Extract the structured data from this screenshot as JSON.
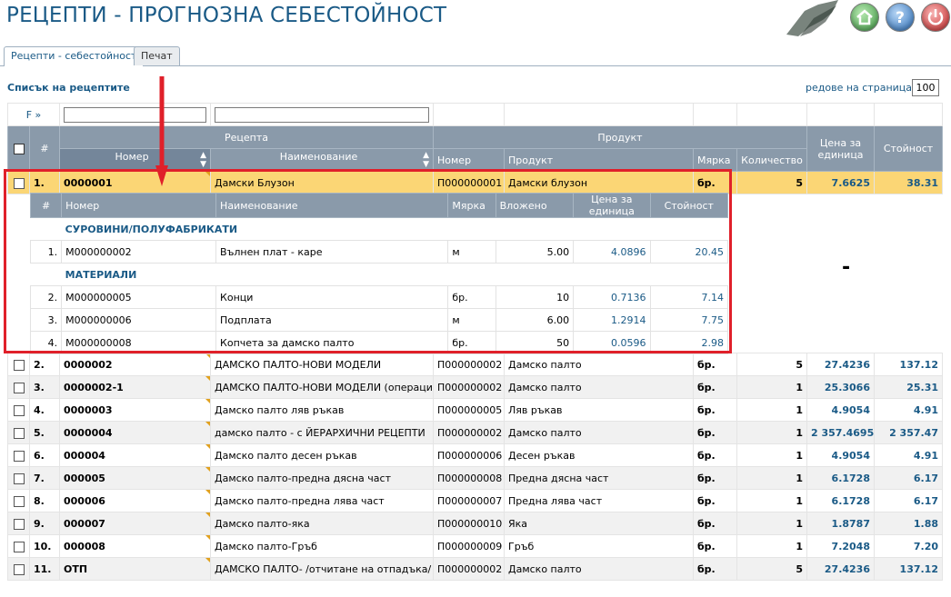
{
  "app": {
    "title": "РЕЦЕПТИ - ПРОГНОЗНА СЕБЕСТОЙНОСТ"
  },
  "header_buttons": [
    {
      "name": "home",
      "icon": "home-icon",
      "color": "#3f9a44"
    },
    {
      "name": "help",
      "icon": "help-icon",
      "color": "#2a6db8"
    },
    {
      "name": "power",
      "icon": "power-icon",
      "color": "#c62828"
    }
  ],
  "tabs": [
    {
      "label": "Рецепти - себестойност",
      "active": true
    },
    {
      "label": "Печат",
      "active": false
    }
  ],
  "list": {
    "title": "Списък на рецептите",
    "rows_label": "редове на страница",
    "rows_arrow": "»",
    "rows_value": "100",
    "filter_label": "F »"
  },
  "columns": {
    "hash": "#",
    "recipe_group": "Рецепта",
    "product_group": "Продукт",
    "number": "Номер",
    "name": "Наименование",
    "prod_number": "Номер",
    "product": "Продукт",
    "unit": "Мярка",
    "quantity": "Количество",
    "unit_price": "Цена за единица",
    "value": "Стойност"
  },
  "rows": [
    {
      "idx": "1.",
      "number": "0000001",
      "name": "Дамски Блузон",
      "prod_number": "П000000001",
      "product": "Дамски блузон",
      "unit": "бр.",
      "qty": "5",
      "price": "7.6625",
      "value": "38.31"
    },
    {
      "idx": "2.",
      "number": "0000002",
      "name": "ДАМСКО ПАЛТО-НОВИ МОДЕЛИ",
      "prod_number": "П000000002",
      "product": "Дамско палто",
      "unit": "бр.",
      "qty": "5",
      "price": "27.4236",
      "value": "137.12"
    },
    {
      "idx": "3.",
      "number": "0000002-1",
      "name": "ДАМСКО ПАЛТО-НОВИ МОДЕЛИ (операции)",
      "prod_number": "П000000002",
      "product": "Дамско палто",
      "unit": "бр.",
      "qty": "1",
      "price": "25.3066",
      "value": "25.31"
    },
    {
      "idx": "4.",
      "number": "0000003",
      "name": "Дамско палто ляв ръкав",
      "prod_number": "П000000005",
      "product": "Ляв ръкав",
      "unit": "бр.",
      "qty": "1",
      "price": "4.9054",
      "value": "4.91"
    },
    {
      "idx": "5.",
      "number": "0000004",
      "name": "дамско палто - с ЙЕРАРХИЧНИ РЕЦЕПТИ",
      "prod_number": "П000000002",
      "product": "Дамско палто",
      "unit": "бр.",
      "qty": "1",
      "price": "2 357.4695",
      "value": "2 357.47"
    },
    {
      "idx": "6.",
      "number": "000004",
      "name": "Дамско палто десен ръкав",
      "prod_number": "П000000006",
      "product": "Десен ръкав",
      "unit": "бр.",
      "qty": "1",
      "price": "4.9054",
      "value": "4.91"
    },
    {
      "idx": "7.",
      "number": "000005",
      "name": "Дамско палто-предна дясна част",
      "prod_number": "П000000008",
      "product": "Предна дясна част",
      "unit": "бр.",
      "qty": "1",
      "price": "6.1728",
      "value": "6.17"
    },
    {
      "idx": "8.",
      "number": "000006",
      "name": "Дамско палто-предна лява част",
      "prod_number": "П000000007",
      "product": "Предна лява част",
      "unit": "бр.",
      "qty": "1",
      "price": "6.1728",
      "value": "6.17"
    },
    {
      "idx": "9.",
      "number": "000007",
      "name": "Дамско палто-яка",
      "prod_number": "П000000010",
      "product": "Яка",
      "unit": "бр.",
      "qty": "1",
      "price": "1.8787",
      "value": "1.88"
    },
    {
      "idx": "10.",
      "number": "000008",
      "name": "Дамско палто-Гръб",
      "prod_number": "П000000009",
      "product": "Гръб",
      "unit": "бр.",
      "qty": "1",
      "price": "7.2048",
      "value": "7.20"
    },
    {
      "idx": "11.",
      "number": "ОТП",
      "name": "ДАМСКО ПАЛТО- /отчитане на отпадъка/",
      "prod_number": "П000000002",
      "product": "Дамско палто",
      "unit": "бр.",
      "qty": "5",
      "price": "27.4236",
      "value": "137.12"
    }
  ],
  "detail": {
    "columns": {
      "hash": "#",
      "number": "Номер",
      "name": "Наименование",
      "unit": "Мярка",
      "input": "Вложено",
      "unit_price": "Цена за единица",
      "value": "Стойност"
    },
    "group1": "СУРОВИНИ/ПОЛУФАБРИКАТИ",
    "group2": "МАТЕРИАЛИ",
    "items": [
      {
        "idx": "1.",
        "number": "M000000002",
        "name": "Вълнен плат - каре",
        "unit": "м",
        "input": "5.00",
        "price": "4.0896",
        "value": "20.45"
      },
      {
        "idx": "2.",
        "number": "M000000005",
        "name": "Конци",
        "unit": "бр.",
        "input": "10",
        "price": "0.7136",
        "value": "7.14"
      },
      {
        "idx": "3.",
        "number": "M000000006",
        "name": "Подплата",
        "unit": "м",
        "input": "6.00",
        "price": "1.2914",
        "value": "7.75"
      },
      {
        "idx": "4.",
        "number": "M000000008",
        "name": "Копчета за дамско палто",
        "unit": "бр.",
        "input": "50",
        "price": "0.0596",
        "value": "2.98"
      }
    ],
    "side_value": "-"
  },
  "colors": {
    "accent": "#1a5a86",
    "header_bg": "#8a9aaa",
    "selected_row": "#fbd675",
    "highlight_box": "#e0202a"
  }
}
